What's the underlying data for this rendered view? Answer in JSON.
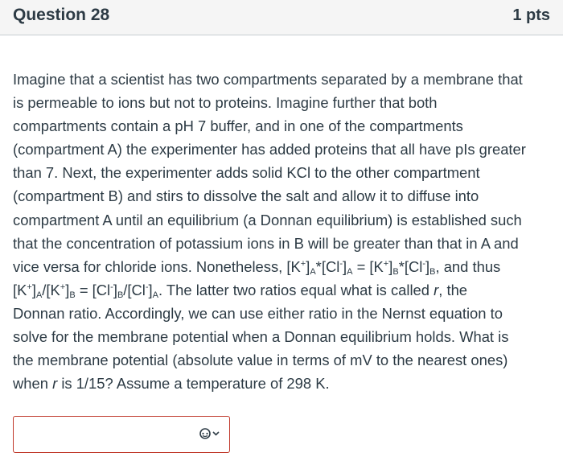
{
  "question": {
    "title": "Question 28",
    "points": "1 pts"
  },
  "body_lines": [
    [
      "Imagine that a scientist has two compartments separated by a membrane that"
    ],
    [
      "is permeable to ions but not to proteins. Imagine further that both"
    ],
    [
      "compartments contain a pH 7 buffer, and in one of the compartments"
    ],
    [
      "(compartment A) the experimenter has added proteins that all have pIs greater"
    ],
    [
      "than 7. Next, the experimenter adds solid KCl to the other compartment"
    ],
    [
      "(compartment B) and stirs to dissolve the salt and allow it to diffuse into"
    ],
    [
      "compartment A until an equilibrium (a Donnan equilibrium) is established such"
    ],
    [
      "that the concentration of potassium ions in B will be greater than that in A and"
    ],
    [
      "vice versa for chloride ions. Nonetheless, [K",
      "+",
      "]",
      "A",
      "*[Cl",
      "-",
      "]",
      "A",
      " = [K",
      "+",
      "]",
      "B",
      "*[Cl",
      "-",
      "]",
      "B",
      ", and thus"
    ],
    [
      "[K",
      "+",
      "]",
      "A",
      "/[K",
      "+",
      "]",
      "B",
      " = [Cl",
      "-",
      "]",
      "B",
      "/[Cl",
      "-",
      "]",
      "A",
      ". The latter two ratios equal what is called ",
      "r",
      ", the"
    ],
    [
      "Donnan ratio. Accordingly, we can use either ratio in the Nernst equation to"
    ],
    [
      "solve for the membrane potential when a Donnan equilibrium holds. What is"
    ],
    [
      "the membrane potential (absolute value in terms of mV to the nearest ones)"
    ],
    [
      "when ",
      "r",
      " is 1/15? Assume a temperature of 298 K."
    ]
  ],
  "answer": {
    "value": "",
    "control_icon": "answer-dropdown-icon"
  },
  "colors": {
    "header_bg": "#f5f5f5",
    "text": "#2d3b45",
    "error_border": "#c0392b"
  }
}
